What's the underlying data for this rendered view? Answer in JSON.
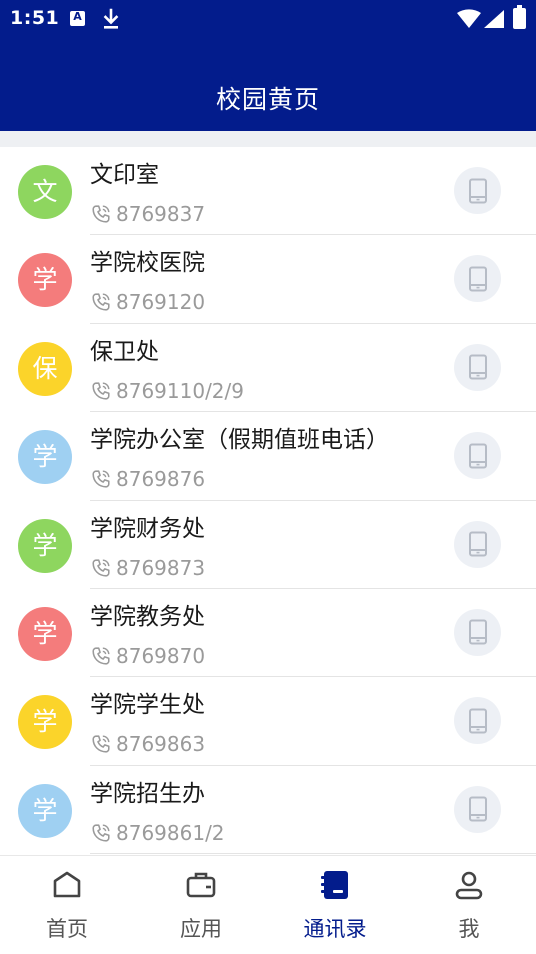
{
  "status_bar": {
    "time": "1:51",
    "icons": [
      "notification-a-icon",
      "download-icon",
      "wifi-icon",
      "cell-signal-icon",
      "battery-icon"
    ]
  },
  "app_bar": {
    "title": "校园黄页"
  },
  "colors": {
    "primary": "#031c8c",
    "avatar_green": "#8ed65f",
    "avatar_red": "#f47c7c",
    "avatar_yellow": "#fbd42a",
    "avatar_blue": "#9fd0f2",
    "phone_text": "#9a9a9a",
    "nav_inactive": "#555555"
  },
  "contacts": [
    {
      "initial": "文",
      "name": "文印室",
      "phone": "8769837",
      "color": "green"
    },
    {
      "initial": "学",
      "name": "学院校医院",
      "phone": "8769120",
      "color": "red"
    },
    {
      "initial": "保",
      "name": "保卫处",
      "phone": "8769110/2/9",
      "color": "yellow"
    },
    {
      "initial": "学",
      "name": "学院办公室（假期值班电话）",
      "phone": "8769876",
      "color": "blue"
    },
    {
      "initial": "学",
      "name": "学院财务处",
      "phone": "8769873",
      "color": "green"
    },
    {
      "initial": "学",
      "name": "学院教务处",
      "phone": "8769870",
      "color": "red"
    },
    {
      "initial": "学",
      "name": "学院学生处",
      "phone": "8769863",
      "color": "yellow"
    },
    {
      "initial": "学",
      "name": "学院招生办",
      "phone": "8769861/2",
      "color": "blue"
    }
  ],
  "bottom_nav": [
    {
      "label": "首页",
      "icon": "home-icon",
      "active": false
    },
    {
      "label": "应用",
      "icon": "briefcase-icon",
      "active": false
    },
    {
      "label": "通讯录",
      "icon": "address-book-icon",
      "active": true
    },
    {
      "label": "我",
      "icon": "person-icon",
      "active": false
    }
  ]
}
